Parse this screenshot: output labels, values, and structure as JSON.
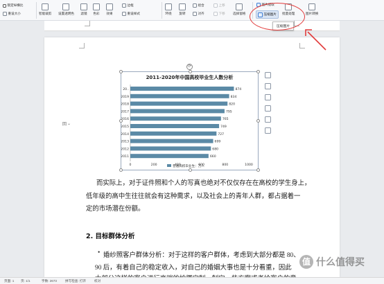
{
  "ribbon": {
    "lock_ratio": "锁定纵横比",
    "reset_size": "重设大小",
    "crop": "智能裁剪",
    "background": "设置透明色",
    "filter": "滤镜",
    "color": "色彩",
    "effect": "效果",
    "outline": "边框",
    "reset_style": "重设样式",
    "wrap": "环绕",
    "rotate": "旋转",
    "align": "对齐",
    "group": "组合",
    "up_layer": "上移",
    "down_layer": "下移",
    "select_pane": "选择窗格",
    "image_extract": "图片提取",
    "compress": "压缩图片",
    "batch": "批量处理",
    "convert": "图片转换",
    "tooltip": "压缩图片"
  },
  "chart_data": {
    "type": "bar",
    "title": "2011-2020年中国高校毕业生人数分析",
    "categories": [
      "20..",
      "2019",
      "2018",
      "2017",
      "2016",
      "2015",
      "2014",
      "2013",
      "2012",
      "2011"
    ],
    "values": [
      874,
      834,
      820,
      795,
      765,
      749,
      727,
      699,
      680,
      660
    ],
    "xticks": [
      "0",
      "200",
      "400",
      "600",
      "800",
      "1000"
    ],
    "xlim": [
      0,
      1000
    ],
    "legend": "普通高校毕业生：万人",
    "color": "#5b8aa6"
  },
  "body": {
    "line1": "而实际上，对于证件照和个人的写真也绝对不仅仅存在在高校的学生身上，",
    "line2": "低年级的高中生往往就会有这种需求，以及社会上的青年人群，都占据着一",
    "line3": "定的市场潜在份额。",
    "heading": "2. 目标群体分析",
    "bullet": "•",
    "line4": "婚纱照客户群体分析：对于这样的客户群体，考虑到大部分都是 80、",
    "line5": "90 后，有着自己的稳定收入，对自己的婚姻大事也是十分看重，因此",
    "line6": "大部分这样的客户进行高端的拍摄定制，制定一些方案或者给客户的意"
  },
  "statusbar": {
    "page": "页面: 1",
    "pages": "页: 1/1",
    "words": "字数: 2673",
    "spell": "拼写检查: 打开",
    "proof": "校对"
  },
  "watermark": {
    "badge": "值",
    "text": "什么值得买"
  },
  "side_marker": "回"
}
